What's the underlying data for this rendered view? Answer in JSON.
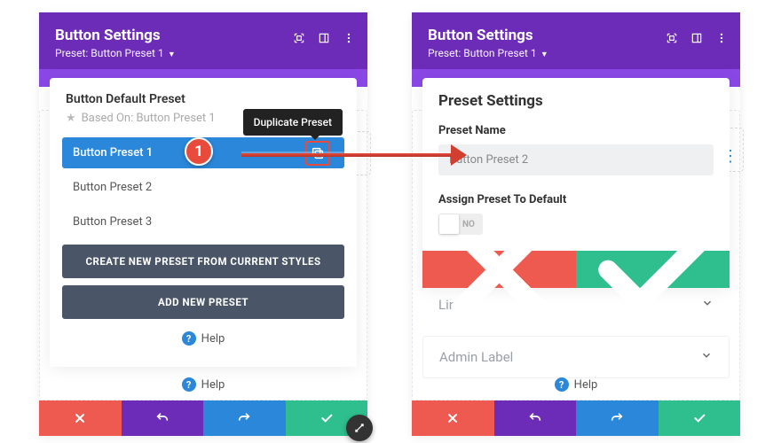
{
  "left": {
    "header": {
      "title": "Button Settings",
      "subtitle": "Preset: Button Preset 1"
    },
    "default_preset_title": "Button Default Preset",
    "based_on": "Based On: Button Preset 1",
    "tooltip": "Duplicate Preset",
    "presets": [
      {
        "label": "Button Preset 1"
      },
      {
        "label": "Button Preset 2"
      },
      {
        "label": "Button Preset 3"
      }
    ],
    "step_badge": "1",
    "create_btn": "CREATE NEW PRESET FROM CURRENT STYLES",
    "add_btn": "ADD NEW PRESET",
    "help": "Help",
    "outer_help": "Help"
  },
  "right": {
    "header": {
      "title": "Button Settings",
      "subtitle": "Preset: Button Preset 1"
    },
    "section_title": "Preset Settings",
    "field_label": "Preset Name",
    "preset_name_value": "Button Preset 2",
    "assign_label": "Assign Preset To Default",
    "toggle_label": "NO",
    "link_row": "Link",
    "admin_row": "Admin Label",
    "help": "Help"
  }
}
